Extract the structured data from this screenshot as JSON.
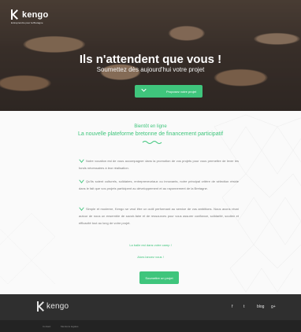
{
  "header": {
    "logo_text": "kengo",
    "logo_tagline": "Entreprendre pour la Bretagne",
    "title": "Ils n'attendent que vous !",
    "subtitle": "Soumettez dès aujourd'hui votre projet",
    "cta_label": "Proposez votre projet"
  },
  "main": {
    "soon": "Bientôt en ligne",
    "tagline": "La nouvelle plateforme bretonne de financement participatif",
    "paragraphs": [
      "Notre vocation est de vous accompagner dans la promotion de vos projets pour vous permettre de lever les fonds nécessaires à leur réalisation.",
      "Qu'ils soient culturels, solidaires, entrepreneuriaux ou innovants, notre principal critère de sélection réside dans le fait que vos projets participent au développement et au rayonnement de la Bretagne.",
      "Simple et moderne, Kengo se veut être un outil performant au service de vos ambitions. Nous avons réuni autour de nous un ensemble de savoir-faire et de ressources pour vous assurer confiance, solidarité, soutien et efficacité tout au long de votre projet."
    ],
    "link1": "La balle est dans votre camp !",
    "link2": "Alors lancez vous !",
    "cta_label": "Soumettre un projet"
  },
  "footer": {
    "logo_text": "kengo",
    "social": [
      "f",
      "t",
      "blog",
      "g+"
    ],
    "links": [
      "Contact",
      "Mentions légales"
    ]
  },
  "colors": {
    "accent": "#3fc57c",
    "footer": "#2f2f2f"
  }
}
